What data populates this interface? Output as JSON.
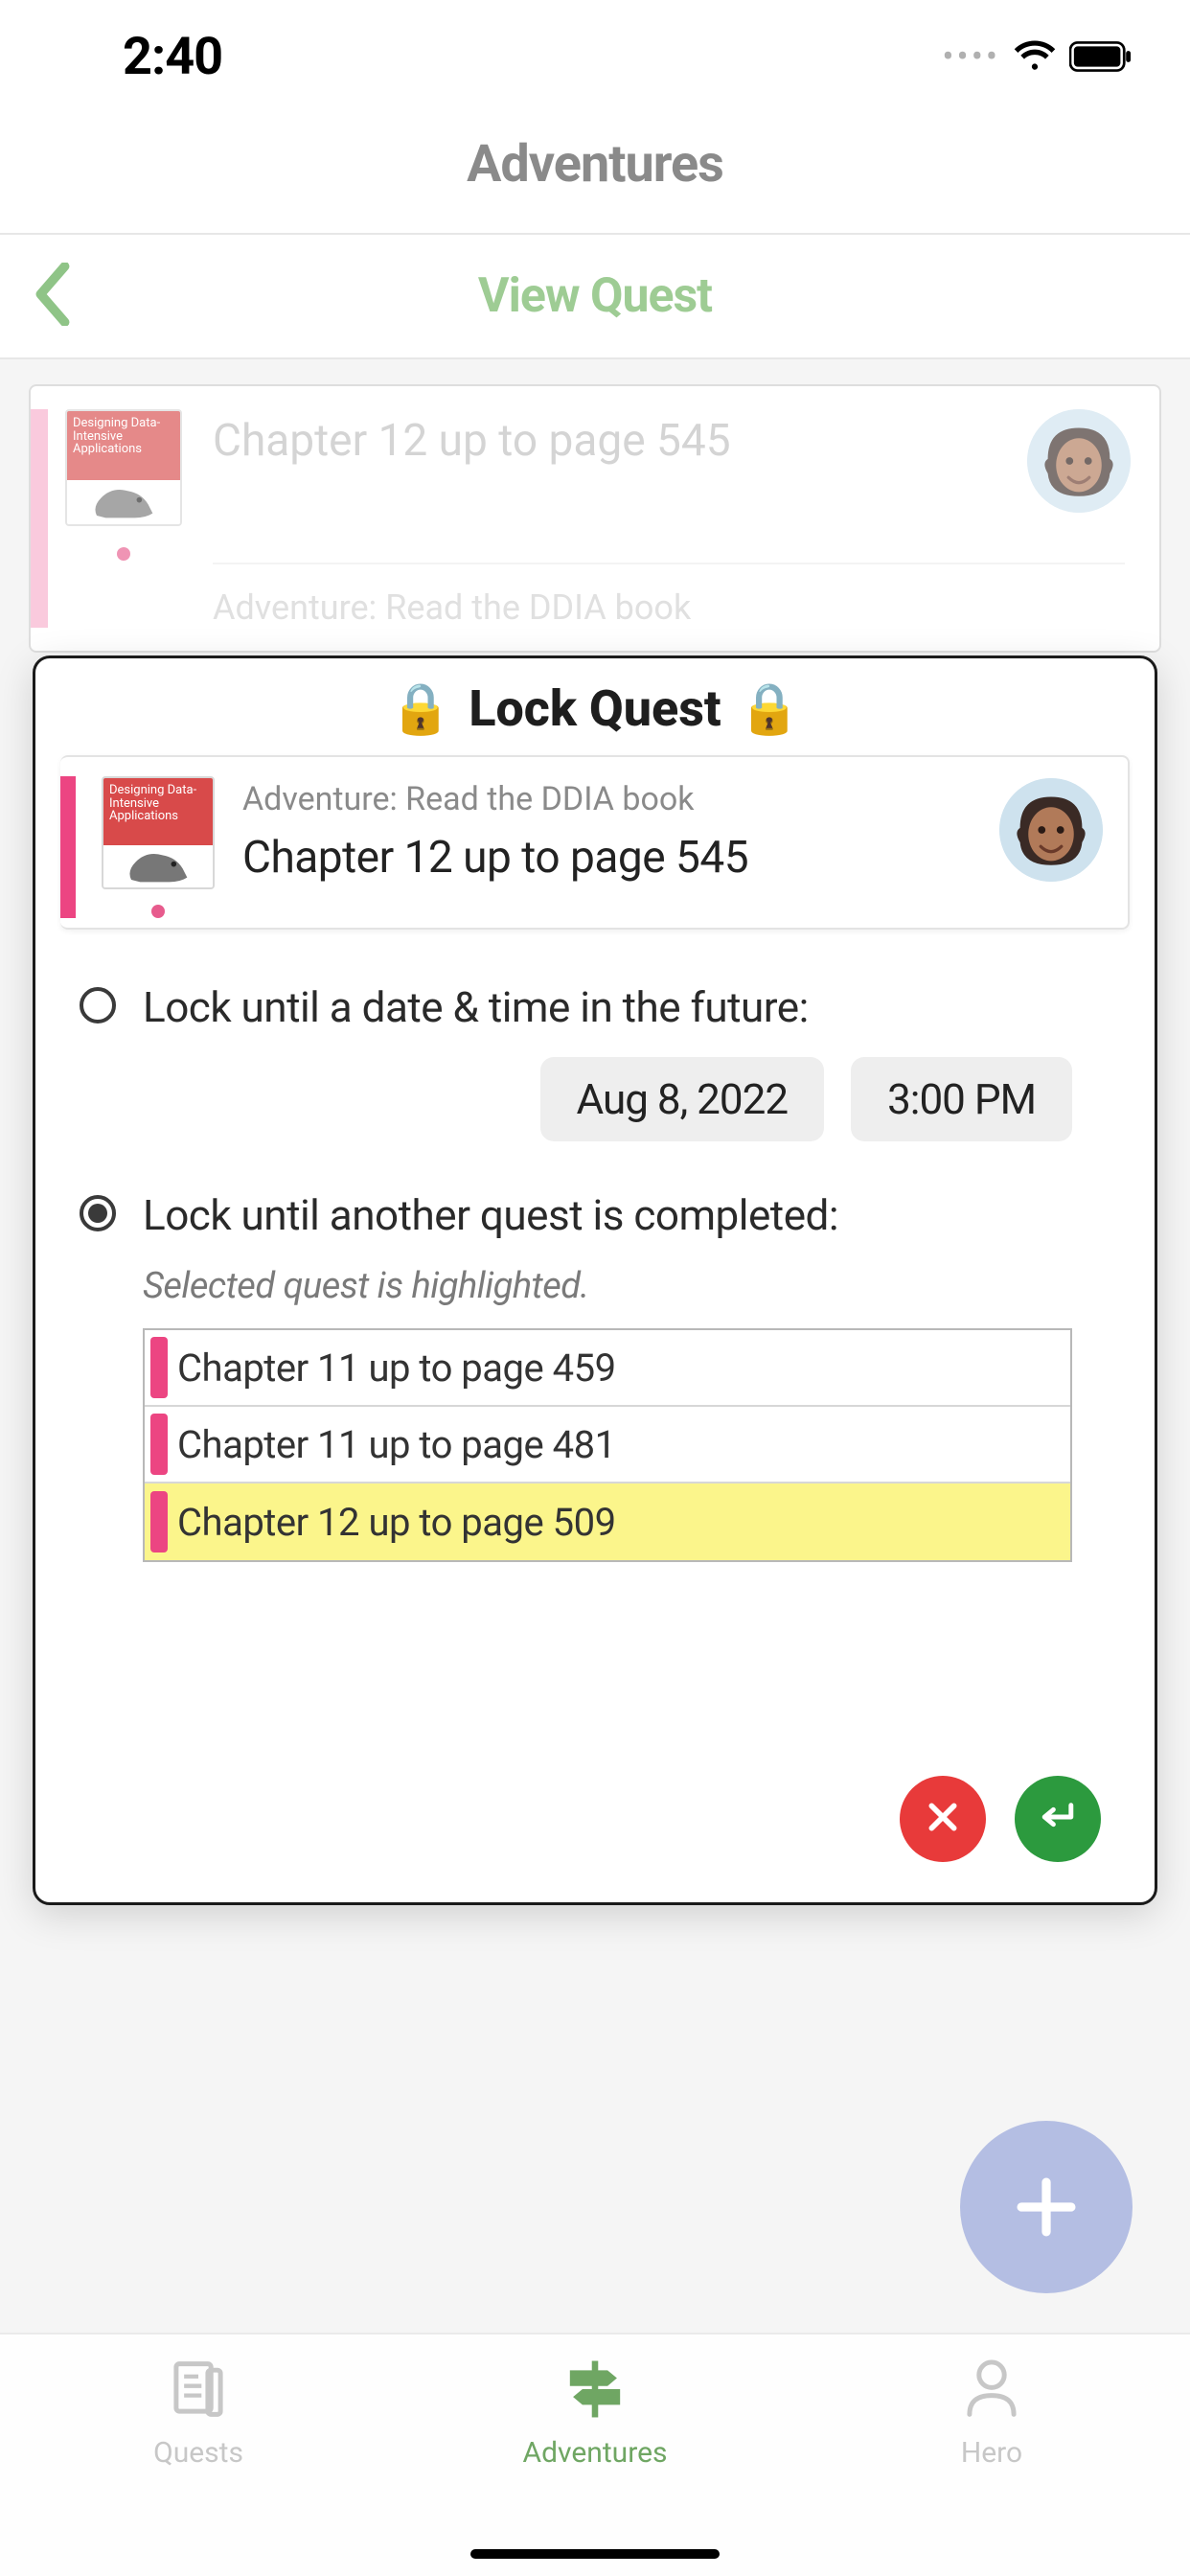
{
  "status_bar": {
    "time": "2:40"
  },
  "header": {
    "app_title": "Adventures",
    "page_title": "View Quest"
  },
  "background_card": {
    "title": "Chapter 12 up to page 545",
    "subtitle": "Adventure: Read the DDIA book",
    "thumb_text": "Designing Data-Intensive Applications"
  },
  "modal": {
    "title": "Lock Quest",
    "quest_card": {
      "subtitle": "Adventure: Read the DDIA book",
      "title": "Chapter 12 up to page 545",
      "thumb_text": "Designing Data-Intensive Applications"
    },
    "option_date": {
      "selected": false,
      "label": "Lock until a date & time in the future:",
      "date": "Aug 8, 2022",
      "time": "3:00 PM"
    },
    "option_quest": {
      "selected": true,
      "label": "Lock until another quest is completed:",
      "hint": "Selected quest is highlighted.",
      "items": [
        {
          "label": "Chapter 11 up to page 459",
          "selected": false
        },
        {
          "label": "Chapter 11 up to page 481",
          "selected": false
        },
        {
          "label": "Chapter 12 up to page 509",
          "selected": true
        }
      ]
    }
  },
  "tabs": {
    "quests": "Quests",
    "adventures": "Adventures",
    "hero": "Hero"
  },
  "colors": {
    "accent_pink": "#ec4582",
    "accent_green": "#6fa663",
    "fab": "#b4bee3",
    "danger": "#e83a3a",
    "confirm": "#2c9a3e"
  }
}
